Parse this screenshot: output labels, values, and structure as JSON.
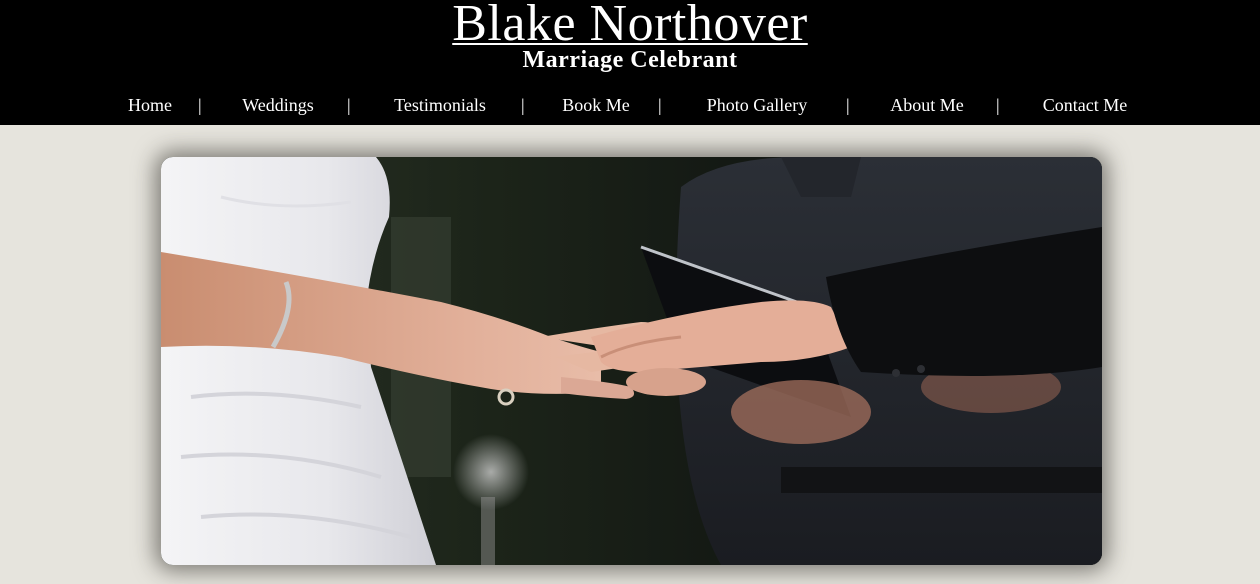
{
  "header": {
    "title": "Blake Northover",
    "subtitle": "Marriage Celebrant"
  },
  "nav": {
    "items": [
      {
        "label": "Home"
      },
      {
        "label": "Weddings"
      },
      {
        "label": "Testimonials"
      },
      {
        "label": "Book Me"
      },
      {
        "label": "Photo Gallery"
      },
      {
        "label": "About Me"
      },
      {
        "label": "Contact Me"
      }
    ],
    "separator": "|"
  },
  "colors": {
    "header_background": "#000000",
    "page_background": "#e6e4dd",
    "text": "#ffffff"
  }
}
